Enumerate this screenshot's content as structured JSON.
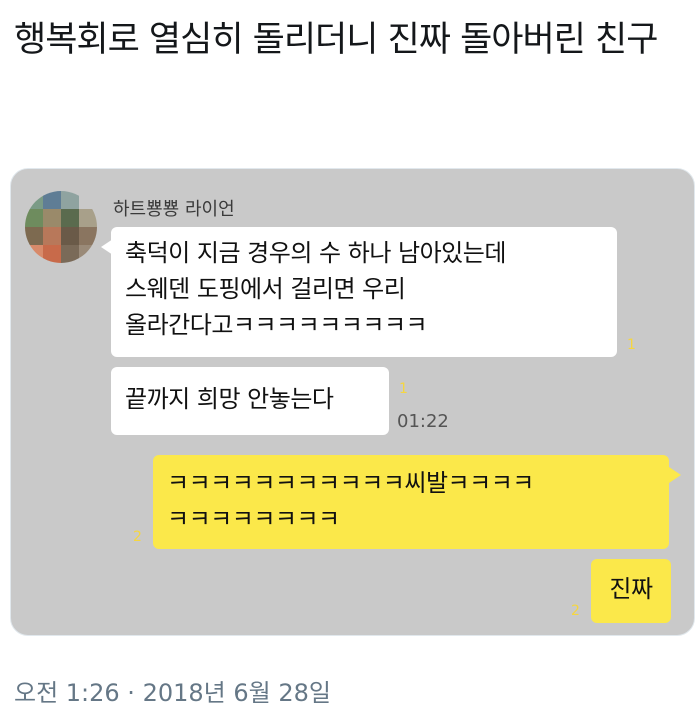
{
  "tweet": {
    "text": "행복회로 열심히 돌리더니 진짜 돌아버린 친구",
    "timestamp": "오전 1:26 · 2018년 6월 28일"
  },
  "chat": {
    "sender_name": "하트뿅뿅 라이언",
    "messages": [
      {
        "side": "in",
        "lines": [
          "축덕이 지금 경우의 수 하나 남아있는데",
          "스웨덴 도핑에서 걸리면 우리",
          "올라간다고ㅋㅋㅋㅋㅋㅋㅋㅋㅋ"
        ],
        "unread": "1"
      },
      {
        "side": "in",
        "lines": [
          "끝까지 희망 안놓는다"
        ],
        "unread": "1",
        "time": "01:22"
      },
      {
        "side": "out",
        "lines": [
          "ㅋㅋㅋㅋㅋㅋㅋㅋㅋㅋㅋ씨발ㅋㅋㅋㅋ",
          "ㅋㅋㅋㅋㅋㅋㅋㅋ"
        ],
        "unread": "2"
      },
      {
        "side": "out",
        "lines": [
          "진짜"
        ],
        "unread": "2"
      }
    ]
  },
  "colors": {
    "chat_bg": "#c9c9c9",
    "bubble_in": "#ffffff",
    "bubble_out": "#fbe84a",
    "unread": "#f5d640",
    "timestamp": "#657786"
  }
}
